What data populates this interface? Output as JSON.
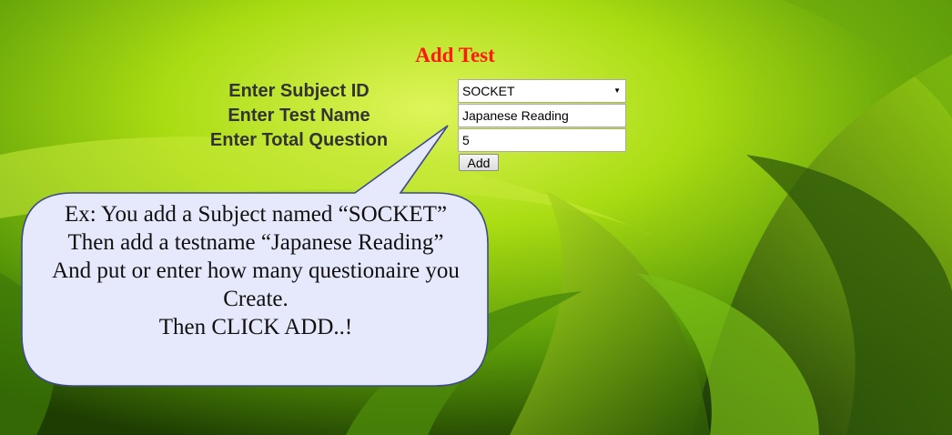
{
  "page": {
    "title": "Add Test"
  },
  "form": {
    "subject_label": "Enter Subject ID",
    "test_name_label": "Enter Test Name",
    "total_question_label": "Enter Total Question",
    "subject_value": "SOCKET",
    "test_name_value": "Japanese Reading",
    "total_question_value": "5",
    "add_label": "Add"
  },
  "callout": {
    "lines": [
      "Ex: You add a Subject named “SOCKET”",
      "Then add a testname “Japanese Reading”",
      "And put or enter how many questionaire you",
      "Create.",
      "Then CLICK ADD..!"
    ]
  },
  "colors": {
    "title": "#ff1a0d",
    "label": "#333333",
    "background": "#8ecb0a",
    "callout_fill": "#e6e8fb"
  },
  "icons": {
    "select": "chevron-down-icon"
  }
}
